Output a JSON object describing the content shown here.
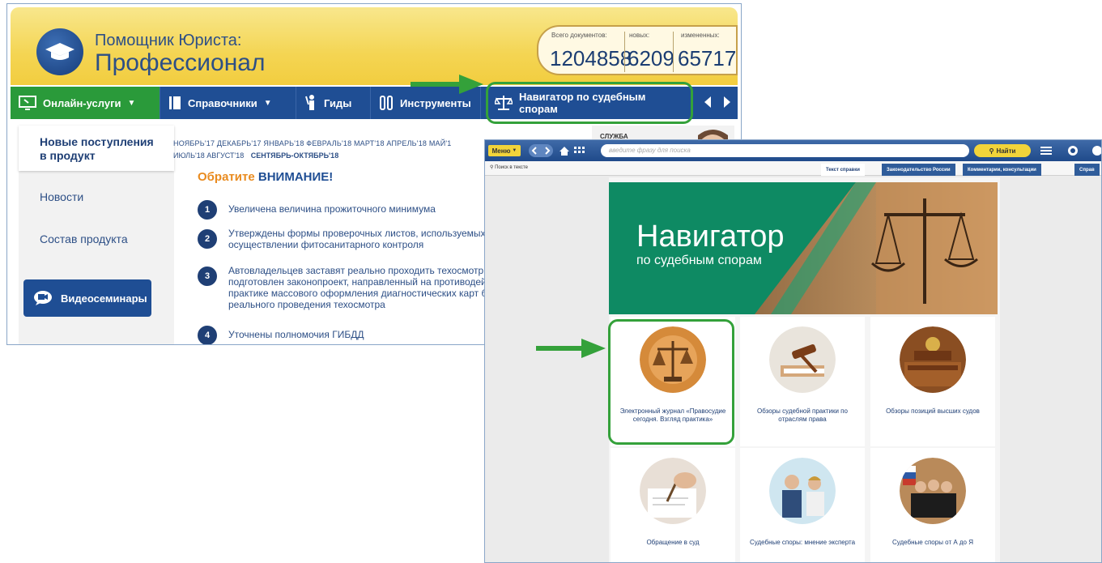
{
  "main_window": {
    "app_name_top": "Помощник Юриста:",
    "app_name_bottom": "Профессионал",
    "stats": [
      {
        "caption": "Всего документов:",
        "value": "1204858"
      },
      {
        "caption": "новых:",
        "value": "6209"
      },
      {
        "caption": "измененных:",
        "value": "65717"
      }
    ],
    "nav": {
      "online": "Онлайн-услуги",
      "refs": "Справочники",
      "guides": "Гиды",
      "tools": "Инструменты",
      "navigator": "Навигатор по судебным спорам"
    },
    "sidebar": {
      "active": "Новые поступления в продукт",
      "news": "Новости",
      "composition": "Состав продукта",
      "video": "Видеосеминары"
    },
    "months_line1": "НОЯБРЬ'17   ДЕКАБРЬ'17   ЯНВАРЬ'18   ФЕВРАЛЬ'18   МАРТ'18   АПРЕЛЬ'18   МАЙ'1",
    "months_line2_prefix": "ИЮЛЬ'18   АВГУСТ'18",
    "months_line2_active": "СЕНТЯБРЬ-ОКТЯБРЬ'18",
    "attention_a": "Обратите",
    "attention_b": "ВНИМАНИЕ!",
    "news_items": [
      {
        "num": "1",
        "text": "Увеличена величина прожиточного минимума"
      },
      {
        "num": "2",
        "text": "Утверждены формы проверочных листов, используемых осуществлении фитосанитарного контроля"
      },
      {
        "num": "3",
        "text": "Автовладельцев заставят реально проходить техосмотр подготовлен законопроект, направленный на противодей практике массового оформления диагностических карт б реального проведения техосмотра"
      },
      {
        "num": "4",
        "text": "Уточнены полномочия ГИБДД"
      }
    ],
    "service_label": "СЛУЖБА"
  },
  "second_window": {
    "menu": "Меню",
    "search_placeholder": "введите фразу для поиска",
    "find": "Найти",
    "search_in_text": "Поиск в тексте",
    "tabs": [
      "Текст справки",
      "Законодательство России",
      "Комментарии, консультации",
      "Справ"
    ],
    "banner_title": "Навигатор",
    "banner_subtitle": "по судебным спорам",
    "cards": [
      {
        "caption": "Электронный журнал «Правосудие сегодня. Взгляд практика»",
        "icon": "scales-icon"
      },
      {
        "caption": "Обзоры судебной практики по отраслям права",
        "icon": "gavel-icon"
      },
      {
        "caption": "Обзоры позиций высших судов",
        "icon": "courtroom-icon"
      },
      {
        "caption": "Обращение в суд",
        "icon": "writing-icon"
      },
      {
        "caption": "Судебные споры: мнение эксперта",
        "icon": "experts-icon"
      },
      {
        "caption": "Судебные споры от А до Я",
        "icon": "judges-icon"
      }
    ]
  },
  "colors": {
    "navy": "#1f4e94",
    "green_highlight": "#34a13a",
    "yellow": "#f4d553",
    "banner_green": "#0e8a63"
  }
}
